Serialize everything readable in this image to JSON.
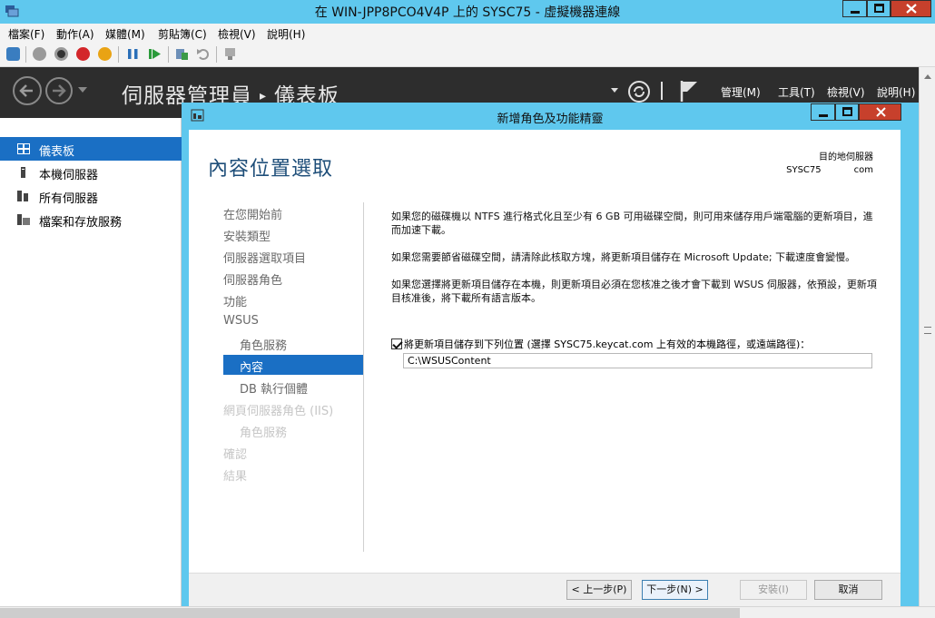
{
  "vm": {
    "title": "在 WIN-JPP8PCO4V4P 上的 SYSC75 - 虛擬機器連線",
    "menu": [
      "檔案(F)",
      "動作(A)",
      "媒體(M)",
      "剪貼簿(C)",
      "檢視(V)",
      "說明(H)"
    ]
  },
  "server_manager": {
    "title": "伺服器管理員",
    "breadcrumb": "儀表板",
    "menu": [
      "管理(M)",
      "工具(T)",
      "檢視(V)",
      "說明(H)"
    ]
  },
  "sidebar": {
    "items": [
      {
        "label": "儀表板",
        "icon": "dashboard-icon",
        "active": true
      },
      {
        "label": "本機伺服器",
        "icon": "local-server-icon"
      },
      {
        "label": "所有伺服器",
        "icon": "all-servers-icon"
      },
      {
        "label": "檔案和存放服務",
        "icon": "file-storage-icon"
      }
    ]
  },
  "wizard": {
    "window_title": "新增角色及功能精靈",
    "heading": "內容位置選取",
    "destination_label": "目的地伺服器",
    "destination_name": "SYSC75",
    "destination_suffix": "com",
    "steps": [
      {
        "label": "在您開始前",
        "state": "normal",
        "sub": false
      },
      {
        "label": "安裝類型",
        "state": "normal",
        "sub": false
      },
      {
        "label": "伺服器選取項目",
        "state": "normal",
        "sub": false
      },
      {
        "label": "伺服器角色",
        "state": "normal",
        "sub": false
      },
      {
        "label": "功能",
        "state": "normal",
        "sub": false
      },
      {
        "label": "WSUS",
        "state": "normal",
        "sub": false
      },
      {
        "label": "角色服務",
        "state": "normal",
        "sub": true
      },
      {
        "label": "內容",
        "state": "active",
        "sub": true
      },
      {
        "label": "DB 執行個體",
        "state": "normal",
        "sub": true
      },
      {
        "label": "網頁伺服器角色 (IIS)",
        "state": "disabled",
        "sub": false
      },
      {
        "label": "角色服務",
        "state": "disabled",
        "sub": true
      },
      {
        "label": "確認",
        "state": "disabled",
        "sub": false
      },
      {
        "label": "結果",
        "state": "disabled",
        "sub": false
      }
    ],
    "paragraphs": [
      "如果您的磁碟機以 NTFS 進行格式化且至少有 6 GB 可用磁碟空間，則可用來儲存用戶端電腦的更新項目，進而加速下載。",
      "如果您需要節省磁碟空間，請清除此核取方塊，將更新項目儲存在 Microsoft Update; 下載速度會變慢。",
      "如果您選擇將更新項目儲存在本機，則更新項目必須在您核准之後才會下載到 WSUS 伺服器，依預設，更新項目核准後，將下載所有語言版本。"
    ],
    "checkbox_label": "將更新項目儲存到下列位置 (選擇 SYSC75.keycat.com 上有效的本機路徑，或遠端路徑)：",
    "checkbox_checked": true,
    "path_value": "C:\\WSUSContent",
    "buttons": {
      "previous": "< 上一步(P)",
      "next": "下一步(N) >",
      "install": "安裝(I)",
      "cancel": "取消"
    }
  }
}
